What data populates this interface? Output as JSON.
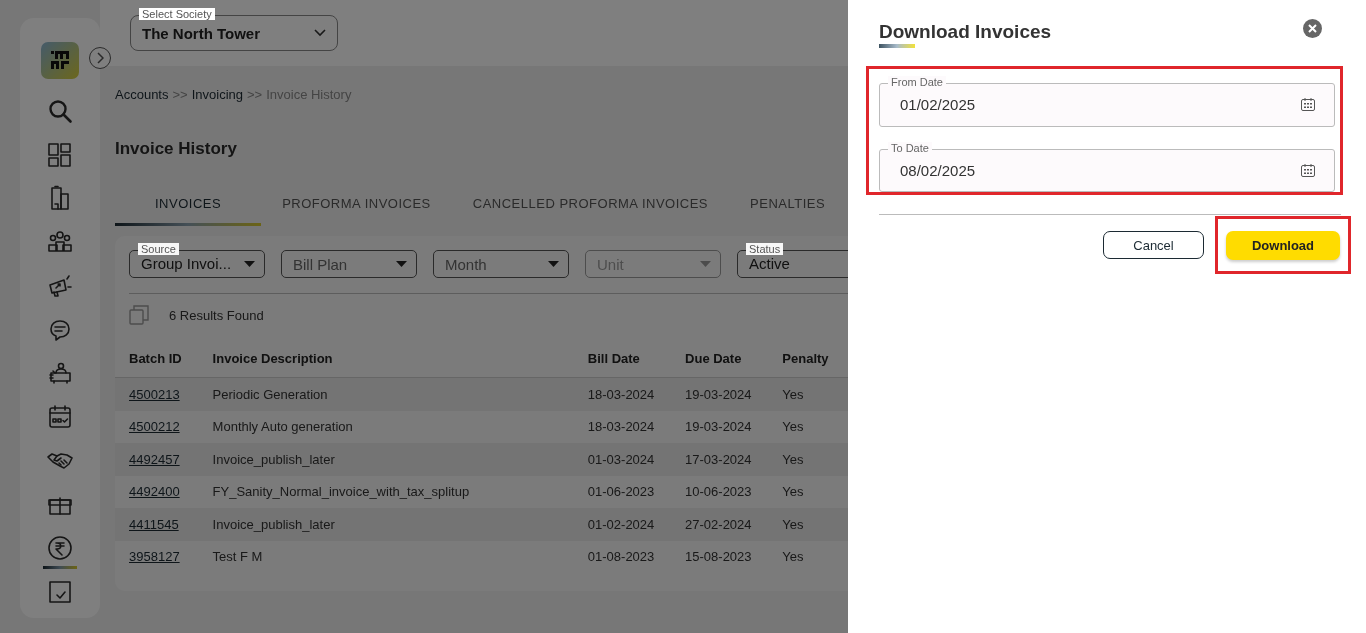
{
  "header": {
    "society": {
      "label": "Select Society",
      "value": "The North Tower"
    }
  },
  "sidebar": {
    "items": [
      {
        "kind": "search",
        "selected": false
      },
      {
        "kind": "dashboard",
        "selected": false
      },
      {
        "kind": "building",
        "selected": false
      },
      {
        "kind": "people",
        "selected": false
      },
      {
        "kind": "megaphone",
        "selected": false
      },
      {
        "kind": "chat",
        "selected": false
      },
      {
        "kind": "desk",
        "selected": false
      },
      {
        "kind": "calendar",
        "selected": false
      },
      {
        "kind": "handshake",
        "selected": false
      },
      {
        "kind": "box",
        "selected": false
      },
      {
        "kind": "rupee",
        "selected": true
      },
      {
        "kind": "report",
        "selected": false
      }
    ]
  },
  "breadcrumb": [
    {
      "text": "Accounts",
      "kind": "link"
    },
    {
      "text": ">>",
      "kind": "separator"
    },
    {
      "text": "Invoicing",
      "kind": "link"
    },
    {
      "text": ">>",
      "kind": "separator"
    },
    {
      "text": "Invoice History",
      "kind": "current"
    }
  ],
  "title": "Invoice History",
  "tabs": [
    {
      "label": "INVOICES",
      "selected": true
    },
    {
      "label": "PROFORMA INVOICES",
      "selected": false
    },
    {
      "label": "CANCELLED PROFORMA INVOICES",
      "selected": false
    },
    {
      "label": "PENALTIES",
      "selected": false
    }
  ],
  "filters": [
    {
      "label": "Source",
      "value": "Group Invoi...",
      "disabled": false
    },
    {
      "placeholder": "Bill Plan",
      "disabled": false
    },
    {
      "placeholder": "Month",
      "disabled": false
    },
    {
      "placeholder": "Unit",
      "disabled": true
    },
    {
      "label": "Status",
      "value": "Active",
      "disabled": false
    }
  ],
  "results": "6 Results Found",
  "table": {
    "columns": [
      "Batch ID",
      "Invoice Description",
      "Bill Date",
      "Due Date",
      "Penalty"
    ],
    "rows": [
      [
        "4500213",
        "Periodic Generation",
        "18-03-2024",
        "19-03-2024",
        "Yes"
      ],
      [
        "4500212",
        "Monthly Auto generation",
        "18-03-2024",
        "19-03-2024",
        "Yes"
      ],
      [
        "4492457",
        "Invoice_publish_later",
        "01-03-2024",
        "17-03-2024",
        "Yes"
      ],
      [
        "4492400",
        "FY_Sanity_Normal_invoice_with_tax_splitup",
        "01-06-2023",
        "10-06-2023",
        "Yes"
      ],
      [
        "4411545",
        "Invoice_publish_later",
        "01-02-2024",
        "27-02-2024",
        "Yes"
      ],
      [
        "3958127",
        "Test F M",
        "01-08-2023",
        "15-08-2023",
        "Yes"
      ]
    ]
  },
  "drawer": {
    "title": "Download Invoices",
    "fields": [
      {
        "label": "From Date",
        "value": "01/02/2025"
      },
      {
        "label": "To Date",
        "value": "08/02/2025"
      }
    ],
    "buttons": [
      {
        "label": "Cancel",
        "kind": "secondary"
      },
      {
        "label": "Download",
        "kind": "primary"
      }
    ]
  }
}
